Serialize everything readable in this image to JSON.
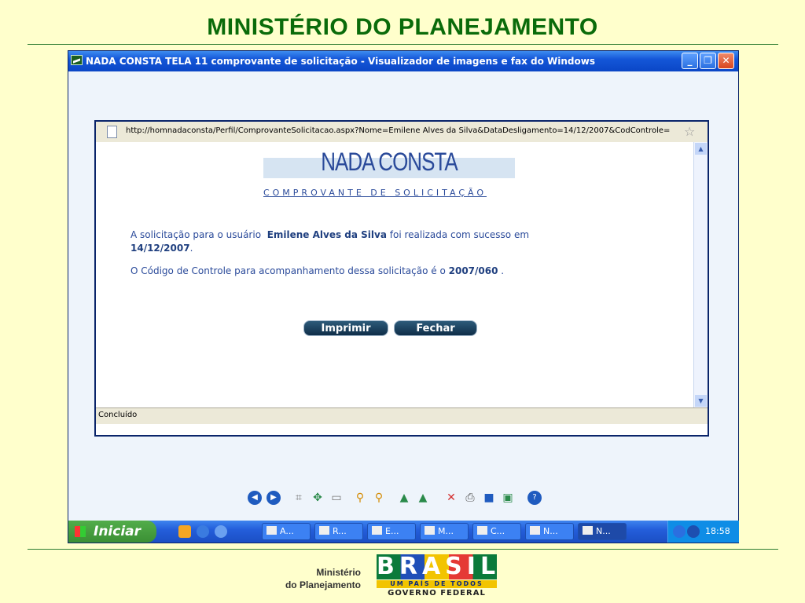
{
  "slide": {
    "title": "MINISTÉRIO DO PLANEJAMENTO",
    "footer_line1": "Ministério",
    "footer_line2": "do Planejamento",
    "brand_word": "BRASIL",
    "brand_slogan": "UM PAÍS DE TODOS",
    "brand_gov": "GOVERNO FEDERAL"
  },
  "viewer": {
    "title": "NADA CONSTA TELA 11 comprovante de solicitação - Visualizador de imagens e fax do Windows",
    "minimize_icon": "minimize-icon",
    "maximize_icon": "maximize-icon",
    "close_icon": "close-icon"
  },
  "browser": {
    "url": "http://homnadaconsta/Perfil/ComprovanteSolicitacao.aspx?Nome=Emilene Alves da Silva&DataDesligamento=14/12/2007&CodControle=",
    "status": "Concluído"
  },
  "page": {
    "logo": "NADA CONSTA",
    "subtitle": "COMPROVANTE DE SOLICITAÇÃO",
    "msg1_pre": "A solicitação para o usuário",
    "user": "Emilene Alves da Silva",
    "msg1_mid": "foi realizada com sucesso em",
    "date": "14/12/2007",
    "msg2_pre": "O Código de Controle para acompanhamento dessa solicitação é o",
    "code": "2007/060",
    "print_label": "Imprimir",
    "close_label": "Fechar"
  },
  "taskbar": {
    "start_label": "Iniciar",
    "tasks": [
      "A...",
      "R...",
      "E...",
      "M...",
      "C...",
      "N...",
      "N..."
    ],
    "clock": "18:58"
  }
}
